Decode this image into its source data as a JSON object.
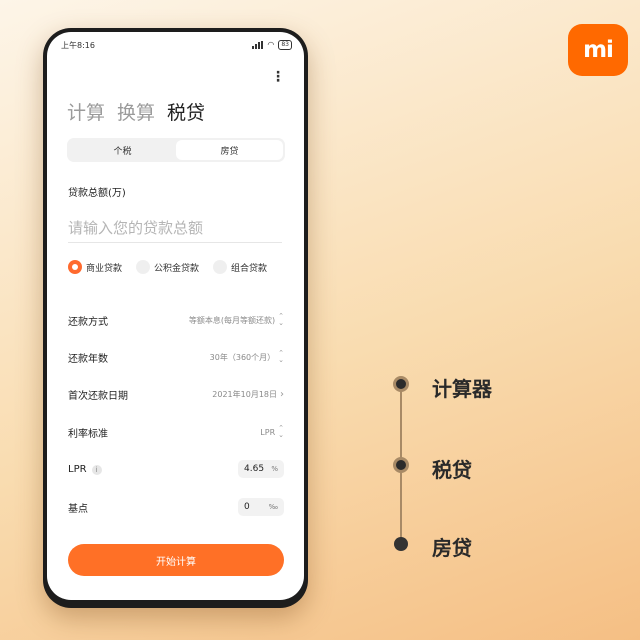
{
  "brand": {
    "logo_text": "mi",
    "color": "#ff6900"
  },
  "status_bar": {
    "time": "上午8:16",
    "battery": "83"
  },
  "top_tabs": [
    {
      "label": "计算",
      "active": false
    },
    {
      "label": "换算",
      "active": false
    },
    {
      "label": "税贷",
      "active": true
    }
  ],
  "segment": {
    "options": [
      "个税",
      "房贷"
    ],
    "selected": "房贷"
  },
  "loan_amount": {
    "label": "贷款总额(万)",
    "placeholder": "请输入您的贷款总额",
    "value": ""
  },
  "loan_types": [
    {
      "label": "商业贷款",
      "selected": true
    },
    {
      "label": "公积金贷款",
      "selected": false
    },
    {
      "label": "组合贷款",
      "selected": false
    }
  ],
  "settings": {
    "repayment_method": {
      "label": "还款方式",
      "value": "等额本息(每月等额还款)"
    },
    "repayment_years": {
      "label": "还款年数",
      "value": "30年（360个月）"
    },
    "first_payment_date": {
      "label": "首次还款日期",
      "value": "2021年10月18日"
    },
    "rate_standard": {
      "label": "利率标准",
      "value": "LPR"
    },
    "lpr": {
      "label": "LPR",
      "value": "4.65",
      "unit": "%"
    },
    "basis_points": {
      "label": "基点",
      "value": "0",
      "unit": "‰"
    }
  },
  "calculate_button": "开始计算",
  "timeline": [
    "计算器",
    "税贷",
    "房贷"
  ],
  "colors": {
    "accent": "#ff7026",
    "timeline_line": "#a88a66"
  }
}
